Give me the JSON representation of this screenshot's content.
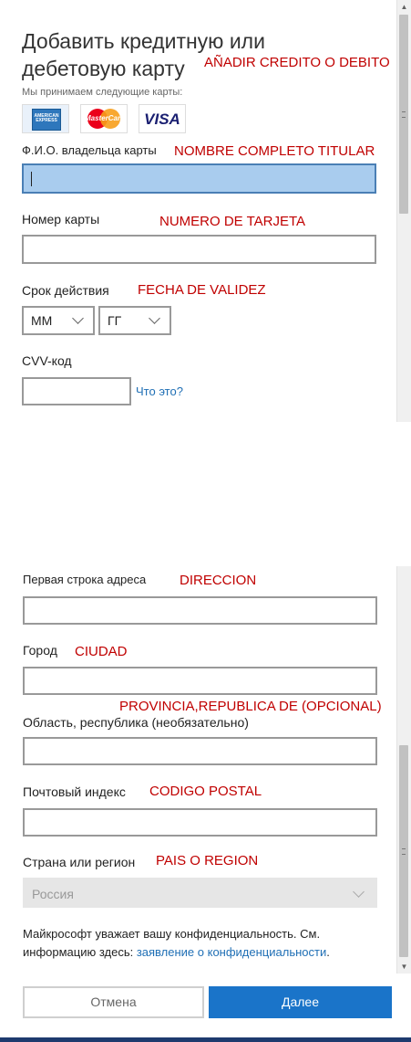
{
  "top_form": {
    "title_line1": "Добавить кредитную или",
    "title_line2": "дебетовую карту",
    "title_annotation": "AÑADIR CREDITO O DEBITO",
    "accepted_cards_label": "Мы принимаем следующие карты:",
    "cards": [
      {
        "icon": "amex-card-icon",
        "text": "AMERICAN EXPRESS",
        "color": "#2e77bc"
      },
      {
        "icon": "mastercard-icon",
        "text": "MasterCard",
        "color": "#eb001b"
      },
      {
        "icon": "visa-icon",
        "text": "VISA",
        "color": "#1a1f71"
      }
    ],
    "name_label": "Ф.И.О. владельца карты",
    "name_annotation": "NOMBRE COMPLETO TITULAR",
    "name_value": "",
    "card_number_label": "Номер карты",
    "card_number_annotation": "NUMERO DE TARJETA",
    "card_number_value": "",
    "expiry_label": "Срок действия",
    "expiry_annotation": "FECHA DE VALIDEZ",
    "month_value": "ММ",
    "year_value": "ГГ",
    "cvv_label": "CVV-код",
    "cvv_value": "",
    "cvv_help_link": "Что это?"
  },
  "bottom_form": {
    "address_label": "Первая строка адреса",
    "address_annotation": "DIRECCION",
    "address_value": "",
    "city_label": "Город",
    "city_annotation": "CIUDAD",
    "city_value": "",
    "region_annotation": "PROVINCIA,REPUBLICA DE (OPCIONAL)",
    "region_label": "Область, республика (необязательно)",
    "region_value": "",
    "postal_label": "Почтовый индекс",
    "postal_annotation": "CODIGO POSTAL",
    "postal_value": "",
    "country_label": "Страна или регион",
    "country_annotation": "PAIS O REGION",
    "country_value": "Россия",
    "privacy_text_1": "Майкрософт уважает вашу конфиденциальность. См.",
    "privacy_text_2": "информацию здесь: ",
    "privacy_link": "заявление о конфиденциальности",
    "privacy_end": ".",
    "cancel_label": "Отмена",
    "next_label": "Далее"
  },
  "colors": {
    "focused_field": "#a9ccee",
    "primary_button": "#1a74c9",
    "annotation_red": "#c00000",
    "link_blue": "#1f6fb5"
  }
}
